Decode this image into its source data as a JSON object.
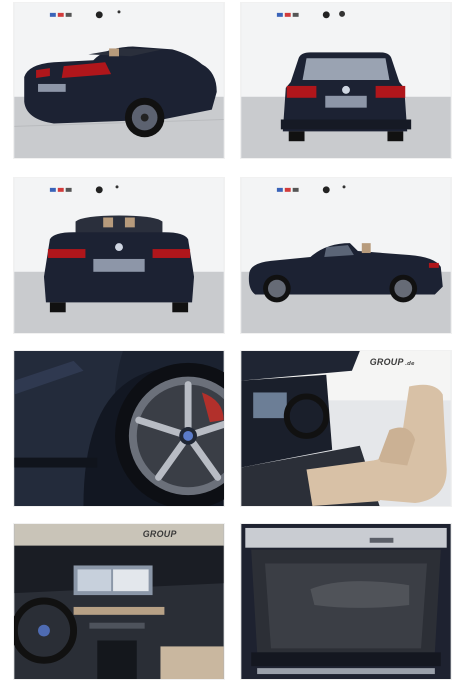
{
  "gallery": {
    "tiles": [
      {
        "subject": "rear-three-quarter-convertible"
      },
      {
        "subject": "rear-suv"
      },
      {
        "subject": "rear-convertible"
      },
      {
        "subject": "side-profile-convertible"
      },
      {
        "subject": "wheel-closeup"
      },
      {
        "subject": "interior-seats"
      },
      {
        "subject": "dashboard"
      },
      {
        "subject": "trunk"
      }
    ],
    "watermark_text": "GROUP",
    "watermark_suffix": ".de"
  },
  "colors": {
    "car_body": "#1c2233",
    "studio_wall": "#f3f4f5",
    "studio_floor": "#c9cbce",
    "leather": "#d8c1a6",
    "taillight": "#b0161b"
  }
}
